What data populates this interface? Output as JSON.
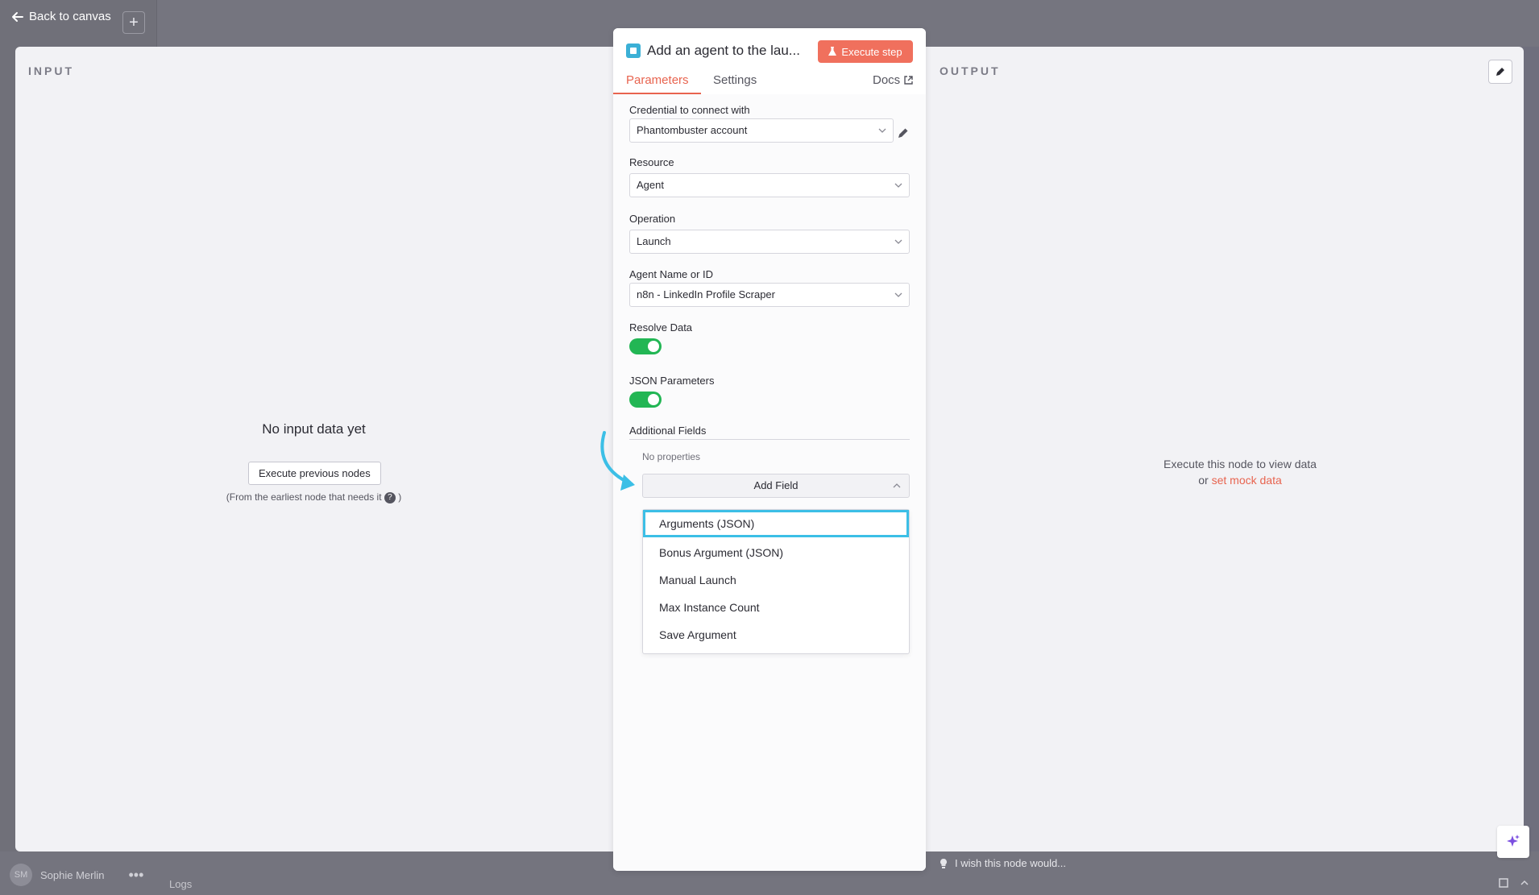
{
  "topbar": {
    "back_label": "Back to canvas",
    "plus_label": "+"
  },
  "bottombar": {
    "user_initials": "SM",
    "user_name": "Sophie Merlin",
    "menu_label": "•••",
    "logs_label": "Logs",
    "wish_label": "I wish this node would..."
  },
  "input_pane": {
    "label": "INPUT",
    "empty_title": "No input data yet",
    "execute_previous_label": "Execute previous nodes",
    "hint_prefix": "(From the earliest node that needs it",
    "hint_suffix": ")",
    "help_glyph": "?"
  },
  "output_pane": {
    "label": "OUTPUT",
    "message_line1": "Execute this node to view data",
    "message_or": "or",
    "mock_link": "set mock data"
  },
  "node": {
    "title": "Add an agent to the lau...",
    "execute_step_label": "Execute step",
    "tabs": [
      {
        "label": "Parameters",
        "active": true
      },
      {
        "label": "Settings",
        "active": false
      }
    ],
    "docs_label": "Docs",
    "fields": {
      "credential": {
        "label": "Credential to connect with",
        "value": "Phantombuster account"
      },
      "resource": {
        "label": "Resource",
        "value": "Agent"
      },
      "operation": {
        "label": "Operation",
        "value": "Launch"
      },
      "agent": {
        "label": "Agent Name or ID",
        "value": "n8n - LinkedIn Profile Scraper"
      },
      "resolve_data": {
        "label": "Resolve Data",
        "enabled": true
      },
      "json_parameters": {
        "label": "JSON Parameters",
        "enabled": true
      }
    },
    "additional_fields": {
      "label": "Additional Fields",
      "no_properties": "No properties",
      "add_field_label": "Add Field",
      "options": [
        {
          "label": "Arguments (JSON)",
          "highlighted": true
        },
        {
          "label": "Bonus Argument (JSON)",
          "highlighted": false
        },
        {
          "label": "Manual Launch",
          "highlighted": false
        },
        {
          "label": "Max Instance Count",
          "highlighted": false
        },
        {
          "label": "Save Argument",
          "highlighted": false
        }
      ]
    }
  },
  "colors": {
    "accent": "#e8644f",
    "execute_button": "#f0705d",
    "toggle_on": "#22b654",
    "highlight": "#3cbfe6"
  }
}
